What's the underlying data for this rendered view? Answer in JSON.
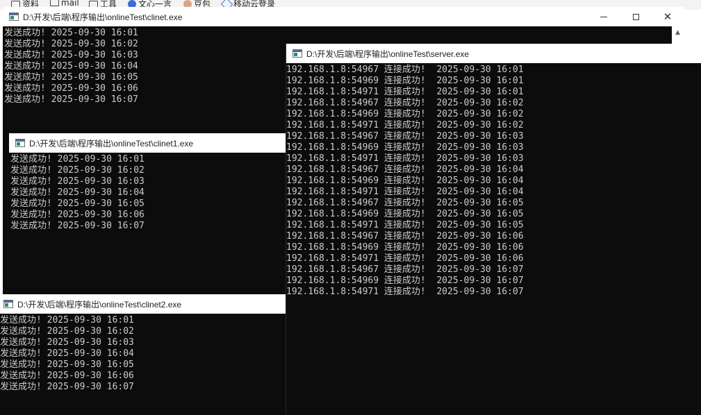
{
  "bookmarks": {
    "items": [
      {
        "label": "资料",
        "icon": "folder-icon"
      },
      {
        "label": "mail",
        "icon": "folder-icon"
      },
      {
        "label": "工具",
        "icon": "folder-icon"
      },
      {
        "label": "文心一言",
        "icon": "baidu-icon"
      },
      {
        "label": "豆包",
        "icon": "doubao-avatar-icon"
      },
      {
        "label": "移动云登录",
        "icon": "cloud-icon"
      }
    ]
  },
  "windows": {
    "clinet": {
      "title": "D:\\开发\\后端\\程序输出\\onlineTest\\clinet.exe",
      "lines": [
        "发送成功! 2025-09-30 16:01",
        "发送成功! 2025-09-30 16:02",
        "发送成功! 2025-09-30 16:03",
        "发送成功! 2025-09-30 16:04",
        "发送成功! 2025-09-30 16:05",
        "发送成功! 2025-09-30 16:06",
        "发送成功! 2025-09-30 16:07"
      ],
      "controls": {
        "minimize": "minimize",
        "maximize": "maximize",
        "close": "close"
      }
    },
    "clinet1": {
      "title": "D:\\开发\\后端\\程序输出\\onlineTest\\clinet1.exe",
      "lines": [
        "发送成功! 2025-09-30 16:01",
        "发送成功! 2025-09-30 16:02",
        "发送成功! 2025-09-30 16:03",
        "发送成功! 2025-09-30 16:04",
        "发送成功! 2025-09-30 16:05",
        "发送成功! 2025-09-30 16:06",
        "发送成功! 2025-09-30 16:07"
      ]
    },
    "clinet2": {
      "title": "D:\\开发\\后端\\程序输出\\onlineTest\\clinet2.exe",
      "lines": [
        "发送成功! 2025-09-30 16:01",
        "发送成功! 2025-09-30 16:02",
        "发送成功! 2025-09-30 16:03",
        "发送成功! 2025-09-30 16:04",
        "发送成功! 2025-09-30 16:05",
        "发送成功! 2025-09-30 16:06",
        "发送成功! 2025-09-30 16:07"
      ]
    },
    "server": {
      "title": "D:\\开发\\后端\\程序输出\\onlineTest\\server.exe",
      "lines": [
        "192.168.1.8:54967 连接成功!  2025-09-30 16:01",
        "192.168.1.8:54969 连接成功!  2025-09-30 16:01",
        "192.168.1.8:54971 连接成功!  2025-09-30 16:01",
        "192.168.1.8:54967 连接成功!  2025-09-30 16:02",
        "192.168.1.8:54969 连接成功!  2025-09-30 16:02",
        "192.168.1.8:54971 连接成功!  2025-09-30 16:02",
        "192.168.1.8:54967 连接成功!  2025-09-30 16:03",
        "192.168.1.8:54969 连接成功!  2025-09-30 16:03",
        "192.168.1.8:54971 连接成功!  2025-09-30 16:03",
        "192.168.1.8:54967 连接成功!  2025-09-30 16:04",
        "192.168.1.8:54969 连接成功!  2025-09-30 16:04",
        "192.168.1.8:54971 连接成功!  2025-09-30 16:04",
        "192.168.1.8:54967 连接成功!  2025-09-30 16:05",
        "192.168.1.8:54969 连接成功!  2025-09-30 16:05",
        "192.168.1.8:54971 连接成功!  2025-09-30 16:05",
        "192.168.1.8:54967 连接成功!  2025-09-30 16:06",
        "192.168.1.8:54969 连接成功!  2025-09-30 16:06",
        "192.168.1.8:54971 连接成功!  2025-09-30 16:06",
        "192.168.1.8:54967 连接成功!  2025-09-30 16:07",
        "192.168.1.8:54969 连接成功!  2025-09-30 16:07",
        "192.168.1.8:54971 连接成功!  2025-09-30 16:07"
      ]
    }
  },
  "colors": {
    "console_bg": "#0c0c0c",
    "console_fg": "#cccccc",
    "titlebar_bg": "#ffffff"
  }
}
